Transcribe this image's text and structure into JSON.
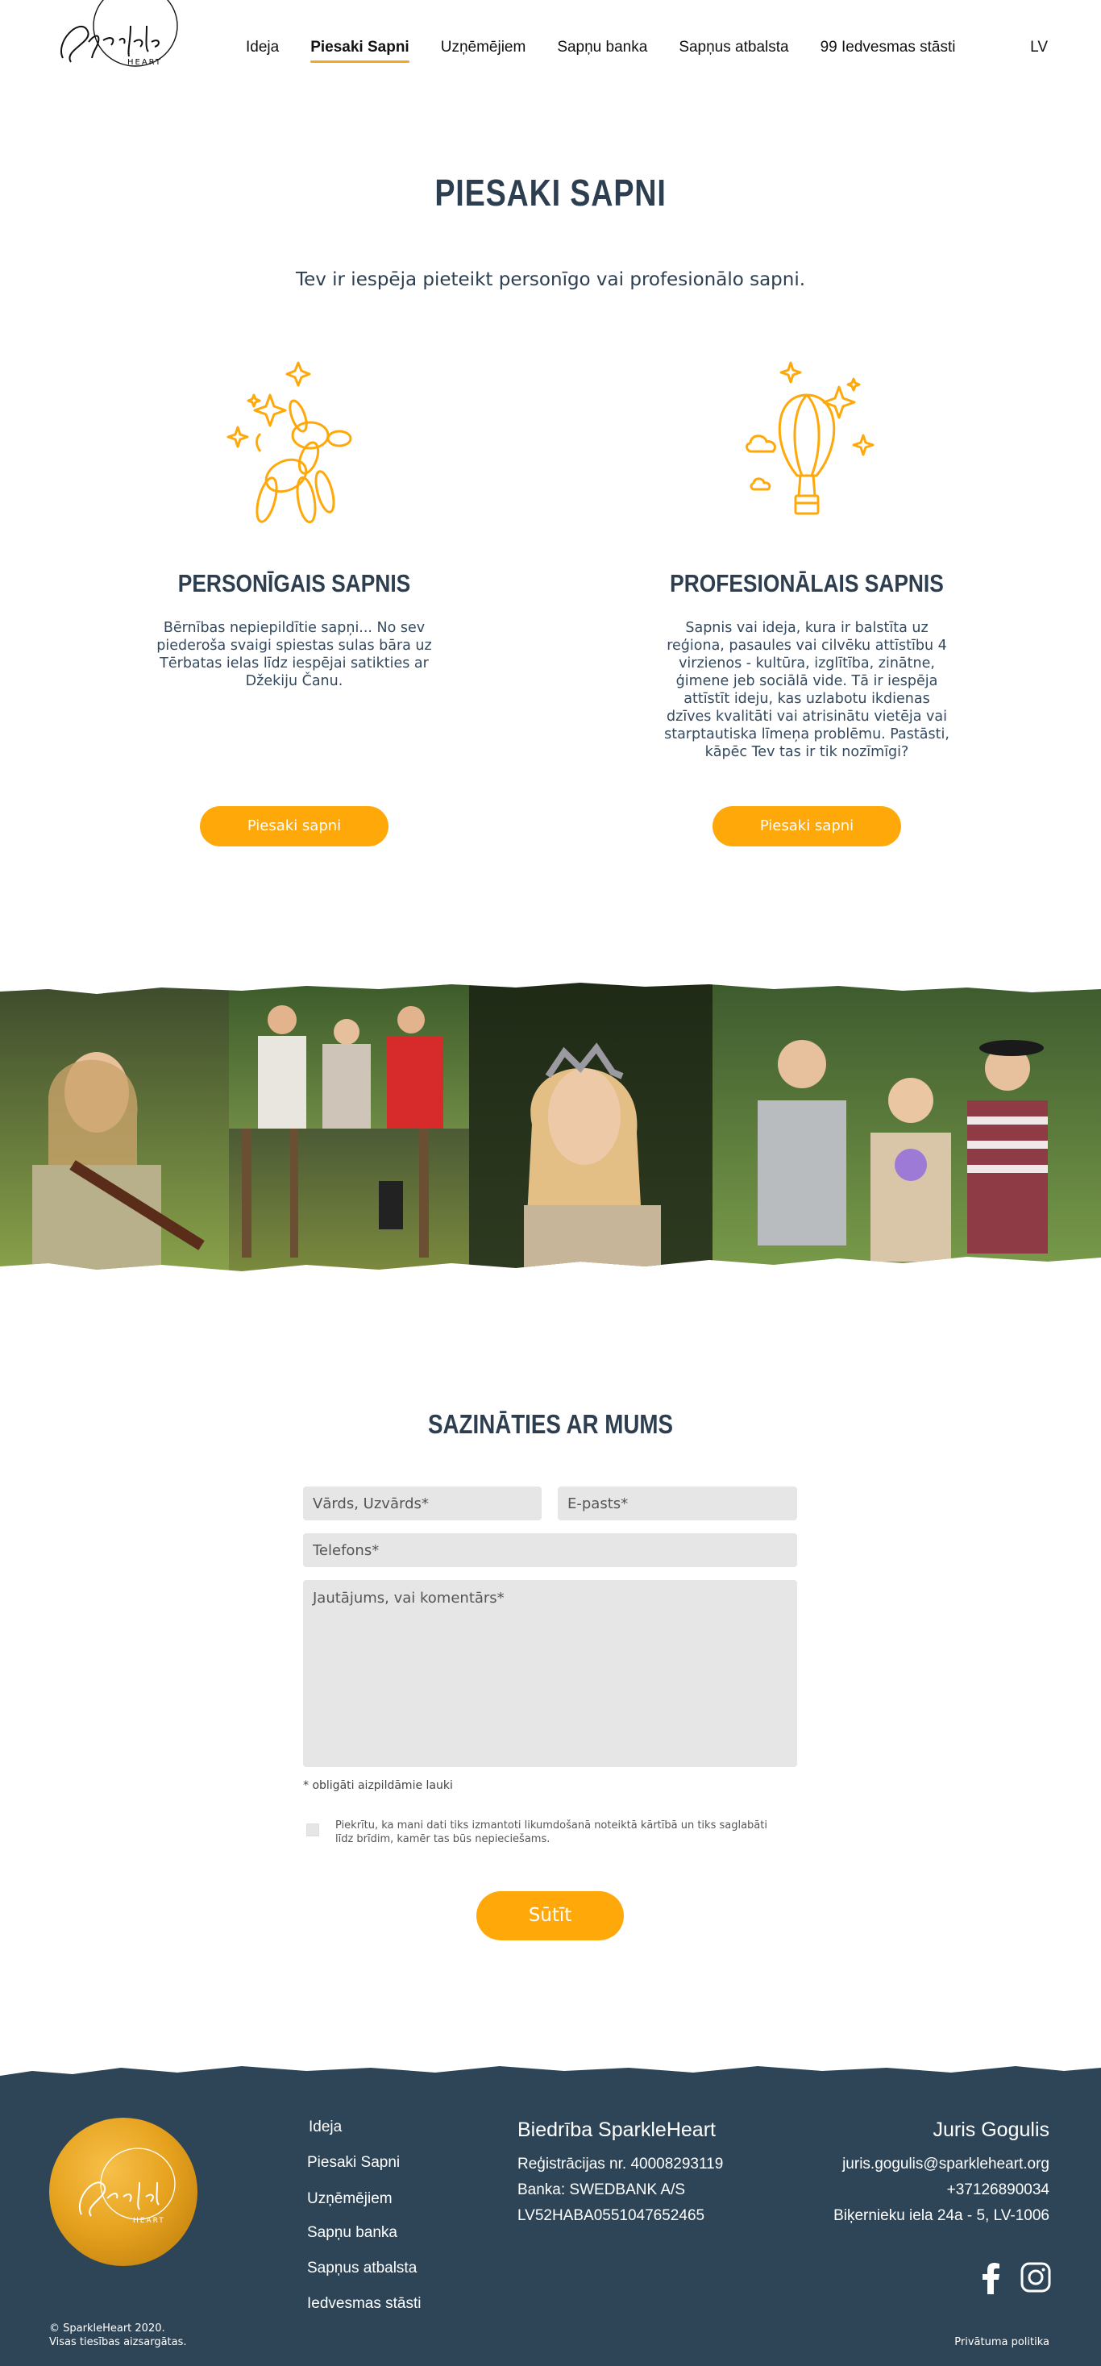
{
  "header": {
    "logo_text": "Sparkle",
    "logo_sub": "HEART",
    "nav": [
      "Ideja",
      "Piesaki Sapni",
      "Uzņēmējiem",
      "Sapņu banka",
      "Sapņus atbalsta",
      "99 Iedvesmas stāsti"
    ],
    "active_nav": "Piesaki Sapni",
    "lang": "LV"
  },
  "hero": {
    "title": "PIESAKI SAPNI",
    "subtitle": "Tev ir iespēja pieteikt personīgo vai profesionālo sapni."
  },
  "options": [
    {
      "icon": "balloon-dog-icon",
      "title": "PERSONĪGAIS SAPNIS",
      "description": "Bērnības nepiepildītie sapņi... No sev piederoša svaigi spiestas sulas bāra uz Tērbatas ielas līdz iespējai satikties ar Džekiju Čanu.",
      "button": "Piesaki sapni"
    },
    {
      "icon": "hot-air-balloon-icon",
      "title": "PROFESIONĀLAIS SAPNIS",
      "description": "Sapnis vai ideja, kura ir balstīta uz reģiona, pasaules vai cilvēku attīstību 4 virzienos - kultūra, izglītība, zinātne, ģimene jeb sociālā vide. Tā ir iespēja attīstīt ideju, kas uzlabotu ikdienas dzīves kvalitāti vai atrisinātu vietēja vai starptautiska līmeņa problēmu. Pastāsti, kāpēc Tev tas ir tik nozīmīgi?",
      "button": "Piesaki sapni"
    }
  ],
  "contact": {
    "title": "SAZINĀTIES AR MUMS",
    "name_placeholder": "Vārds, Uzvārds*",
    "email_placeholder": "E-pasts*",
    "phone_placeholder": "Telefons*",
    "message_placeholder": "Jautājums, vai komentārs*",
    "required_note": "* obligāti aizpildāmie lauki",
    "consent": "Piekrītu, ka mani dati tiks izmantoti likumdošanā noteiktā kārtībā un tiks saglabāti līdz brīdim, kamēr tas būs nepieciešams.",
    "submit": "Sūtīt"
  },
  "footer": {
    "nav": [
      "Ideja",
      "Piesaki Sapni",
      "Uzņēmējiem",
      "Sapņu banka",
      "Sapņus atbalsta",
      "Iedvesmas stāsti"
    ],
    "org_title": "Biedrība SparkleHeart",
    "org_lines": [
      "Reģistrācijas nr. 40008293119",
      "Banka: SWEDBANK A/S",
      "LV52HABA0551047652465"
    ],
    "person_name": "Juris Gogulis",
    "person_lines": [
      "juris.gogulis@sparkleheart.org",
      "+37126890034",
      "Biķernieku iela 24a - 5, LV-1006"
    ],
    "copyright_1": "© SparkleHeart 2020.",
    "copyright_2": "Visas tiesības aizsargātas.",
    "privacy": "Privātuma politika"
  },
  "colors": {
    "accent": "#ffa80a",
    "dark": "#2e4557",
    "text": "#2c3e50"
  }
}
